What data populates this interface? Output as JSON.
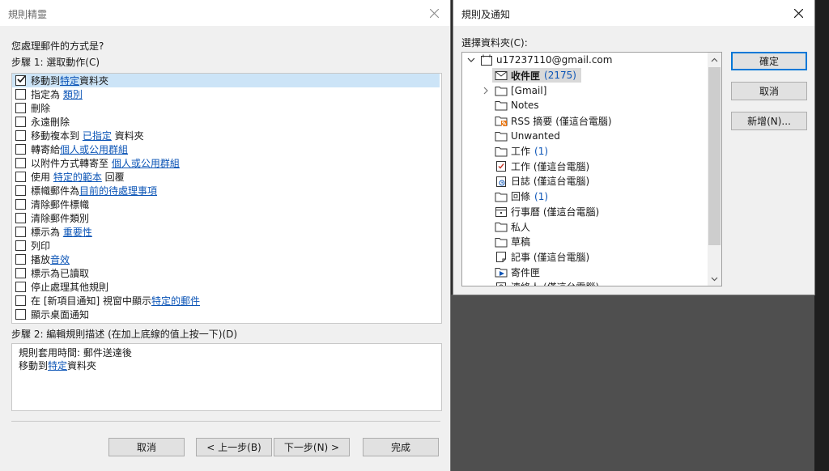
{
  "wizard": {
    "title": "規則精靈",
    "question": "您處理郵件的方式是?",
    "step1_label": "步驟 1: 選取動作(C)",
    "actions": [
      {
        "parts": [
          {
            "t": "移動到"
          },
          {
            "t": "特定",
            "link": true
          },
          {
            "t": "資料夾"
          }
        ],
        "checked": true
      },
      {
        "parts": [
          {
            "t": "指定為 "
          },
          {
            "t": "類別",
            "link": true
          }
        ],
        "checked": false
      },
      {
        "parts": [
          {
            "t": "刪除"
          }
        ],
        "checked": false
      },
      {
        "parts": [
          {
            "t": "永遠刪除"
          }
        ],
        "checked": false
      },
      {
        "parts": [
          {
            "t": "移動複本到 "
          },
          {
            "t": "已指定",
            "link": true
          },
          {
            "t": " 資料夾"
          }
        ],
        "checked": false
      },
      {
        "parts": [
          {
            "t": "轉寄給"
          },
          {
            "t": "個人或公用群組",
            "link": true
          }
        ],
        "checked": false
      },
      {
        "parts": [
          {
            "t": "以附件方式轉寄至 "
          },
          {
            "t": "個人或公用群組",
            "link": true
          }
        ],
        "checked": false
      },
      {
        "parts": [
          {
            "t": "使用 "
          },
          {
            "t": "特定的範本",
            "link": true
          },
          {
            "t": " 回覆"
          }
        ],
        "checked": false
      },
      {
        "parts": [
          {
            "t": "標幟郵件為"
          },
          {
            "t": "目前的待處理事項",
            "link": true
          }
        ],
        "checked": false
      },
      {
        "parts": [
          {
            "t": "清除郵件標幟"
          }
        ],
        "checked": false
      },
      {
        "parts": [
          {
            "t": "清除郵件類別"
          }
        ],
        "checked": false
      },
      {
        "parts": [
          {
            "t": "標示為 "
          },
          {
            "t": "重要性",
            "link": true
          }
        ],
        "checked": false
      },
      {
        "parts": [
          {
            "t": "列印"
          }
        ],
        "checked": false
      },
      {
        "parts": [
          {
            "t": "播放"
          },
          {
            "t": "音效",
            "link": true
          }
        ],
        "checked": false
      },
      {
        "parts": [
          {
            "t": "標示為已讀取"
          }
        ],
        "checked": false
      },
      {
        "parts": [
          {
            "t": "停止處理其他規則"
          }
        ],
        "checked": false
      },
      {
        "parts": [
          {
            "t": "在 [新項目通知] 視窗中顯示"
          },
          {
            "t": "特定的郵件",
            "link": true
          }
        ],
        "checked": false
      },
      {
        "parts": [
          {
            "t": "顯示桌面通知"
          }
        ],
        "checked": false
      }
    ],
    "step2_label": "步驟 2: 編輯規則描述 (在加上底線的值上按一下)(D)",
    "description": [
      {
        "parts": [
          {
            "t": "規則套用時間: 郵件送達後"
          }
        ]
      },
      {
        "parts": [
          {
            "t": "移動到"
          },
          {
            "t": "特定",
            "link": true
          },
          {
            "t": "資料夾"
          }
        ]
      }
    ],
    "buttons": {
      "cancel": "取消",
      "back": "< 上一步(B)",
      "next": "下一步(N) >",
      "finish": "完成"
    }
  },
  "folders": {
    "title": "規則及通知",
    "select_label": "選擇資料夾(C):",
    "account": "u17237110@gmail.com",
    "items": [
      {
        "name": "收件匣",
        "count": "(2175)",
        "icon": "mail-icon",
        "bold": true,
        "selected": true
      },
      {
        "name": "[Gmail]",
        "count": "",
        "icon": "folder-icon",
        "expandable": true
      },
      {
        "name": "Notes",
        "count": "",
        "icon": "folder-icon"
      },
      {
        "name": "RSS 摘要 (僅這台電腦)",
        "count": "",
        "icon": "rss-icon"
      },
      {
        "name": "Unwanted",
        "count": "",
        "icon": "folder-icon"
      },
      {
        "name": "工作",
        "count": "(1)",
        "icon": "folder-icon"
      },
      {
        "name": "工作 (僅這台電腦)",
        "count": "",
        "icon": "task-icon"
      },
      {
        "name": "日誌 (僅這台電腦)",
        "count": "",
        "icon": "journal-icon"
      },
      {
        "name": "回條",
        "count": "(1)",
        "icon": "folder-icon"
      },
      {
        "name": "行事曆 (僅這台電腦)",
        "count": "",
        "icon": "calendar-icon"
      },
      {
        "name": "私人",
        "count": "",
        "icon": "folder-icon"
      },
      {
        "name": "草稿",
        "count": "",
        "icon": "folder-icon"
      },
      {
        "name": "記事 (僅這台電腦)",
        "count": "",
        "icon": "note-icon"
      },
      {
        "name": "寄件匣",
        "count": "",
        "icon": "outbox-icon"
      },
      {
        "name": "連絡人 (僅這台電腦)",
        "count": "",
        "icon": "contacts-icon"
      }
    ],
    "buttons": {
      "ok": "確定",
      "cancel": "取消",
      "new": "新增(N)..."
    }
  }
}
